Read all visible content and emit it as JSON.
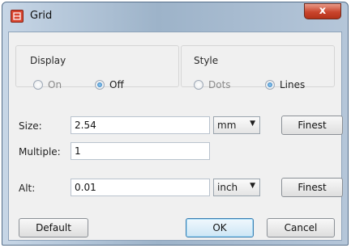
{
  "window": {
    "title": "Grid",
    "close_label": "x"
  },
  "display": {
    "title": "Display",
    "on_label": "On",
    "off_label": "Off",
    "selected": "Off"
  },
  "style": {
    "title": "Style",
    "dots_label": "Dots",
    "lines_label": "Lines",
    "selected": "Lines"
  },
  "size": {
    "label": "Size:",
    "value": "2.54",
    "unit": "mm",
    "finest_label": "Finest"
  },
  "multiple": {
    "label": "Multiple:",
    "value": "1"
  },
  "alt": {
    "label": "Alt:",
    "value": "0.01",
    "unit": "inch",
    "finest_label": "Finest"
  },
  "buttons": {
    "default": "Default",
    "ok": "OK",
    "cancel": "Cancel"
  },
  "icons": {
    "app": "grid-app-icon",
    "dropdown": "chevron-down-icon",
    "close": "close-icon"
  },
  "colors": {
    "close_button": "#c9452d",
    "app_icon": "#d8452f",
    "focus_border": "#3c7fb1"
  }
}
